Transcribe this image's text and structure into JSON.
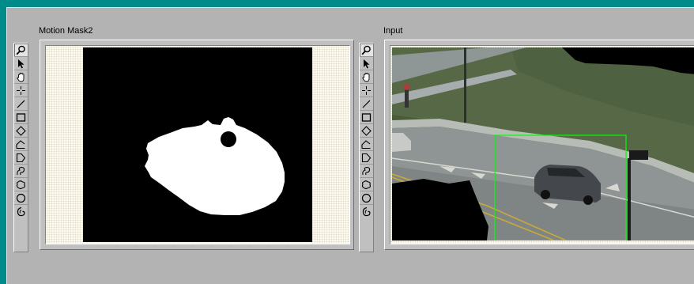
{
  "panels": {
    "left": {
      "title": "Motion Mask2"
    },
    "right": {
      "title": "Input"
    }
  },
  "toolbar": {
    "tools": [
      "zoom-icon",
      "pointer-icon",
      "hand-icon",
      "crosshair-icon",
      "line-icon",
      "rectangle-icon",
      "diamond-icon",
      "polyline-icon",
      "polygon-icon",
      "freehand-icon",
      "closed-freehand-icon",
      "ellipse-icon",
      "magic-wand-icon"
    ]
  },
  "colors": {
    "desktop": "#008b8b",
    "frame": "#b3b3b3",
    "selection_box": "#00ff00"
  }
}
